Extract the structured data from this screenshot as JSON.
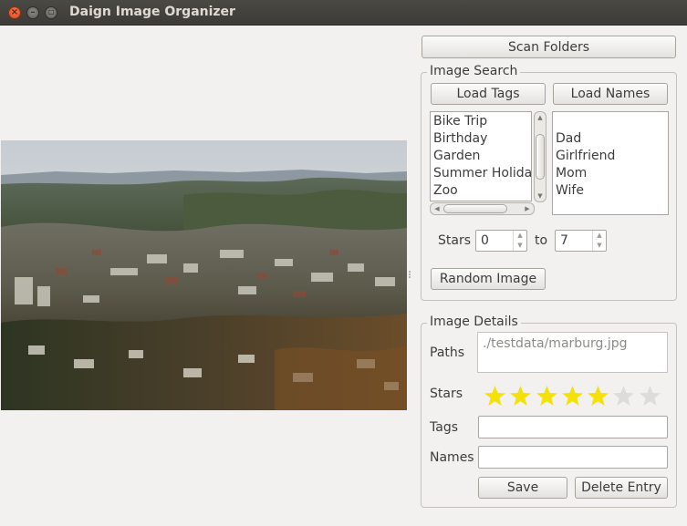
{
  "window": {
    "title": "Daign Image Organizer"
  },
  "sidebar": {
    "scan_button": "Scan Folders",
    "search": {
      "title": "Image Search",
      "load_tags": "Load Tags",
      "load_names": "Load Names",
      "tags": [
        "Bike Trip",
        "Birthday",
        "Garden",
        "Summer Holiday",
        "Zoo"
      ],
      "names": [
        "Dad",
        "Girlfriend",
        "Mom",
        "Wife"
      ],
      "stars_label": "Stars",
      "stars_from": "0",
      "to_label": "to",
      "stars_to": "7",
      "random_button": "Random Image"
    },
    "details": {
      "title": "Image Details",
      "paths_label": "Paths",
      "paths_value": "./testdata/marburg.jpg",
      "stars_label": "Stars",
      "rating": 5,
      "rating_max": 7,
      "star_on_color": "#f5e10a",
      "star_off_color": "#dedcd9",
      "tags_label": "Tags",
      "tags_value": "",
      "names_label": "Names",
      "names_value": "",
      "save_button": "Save",
      "delete_button": "Delete Entry"
    }
  }
}
